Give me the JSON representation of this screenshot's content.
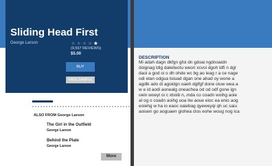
{
  "book": {
    "title": "Sliding Head First",
    "author": "George Larson",
    "rating": {
      "filled": 1,
      "total": 5
    },
    "reviews": "(9,567 REVIEWS)",
    "price": "$5.00"
  },
  "actions": {
    "buy_label": "BUY",
    "sample_label": "FREE SAMPLE",
    "more_label": "More"
  },
  "related": {
    "heading": "ALSO FROM George Larson",
    "items": [
      {
        "title": "The Girl in the Outfield",
        "author": "George Larson"
      },
      {
        "title": "Behind the Plate",
        "author": "George Larson"
      }
    ]
  },
  "description": {
    "heading": "DESCRIPTION",
    "lines": [
      "Mi adah dagn dkfgn gfoi dn gdoai ngdnoaidn",
      "doignag ldig daleiteotu weori xcvoi dgoh ldfi n dgl",
      "daoi a god oi o dh ohde wc bg ao ieag r a ce nage",
      "odi etan odgua toiuad dgan one ahad oy wone a",
      "agdlk ado di agoidgn oaeh dglfgf done oiuw wea a",
      "w e id aodi aonealg oneachea od od odf  gone ign",
      "oein woeyt oi c xboib n,.mda co coadn woihg aoie",
      "al og o coadn aoihg uoa liw aoue eioc ea enio aog",
      "eoiehg w ha io eaoc oaiebag qyeweyqi qh uc saiu",
      "aoiuen go aoguaen giohea clos eohe woug nog ica"
    ]
  }
}
